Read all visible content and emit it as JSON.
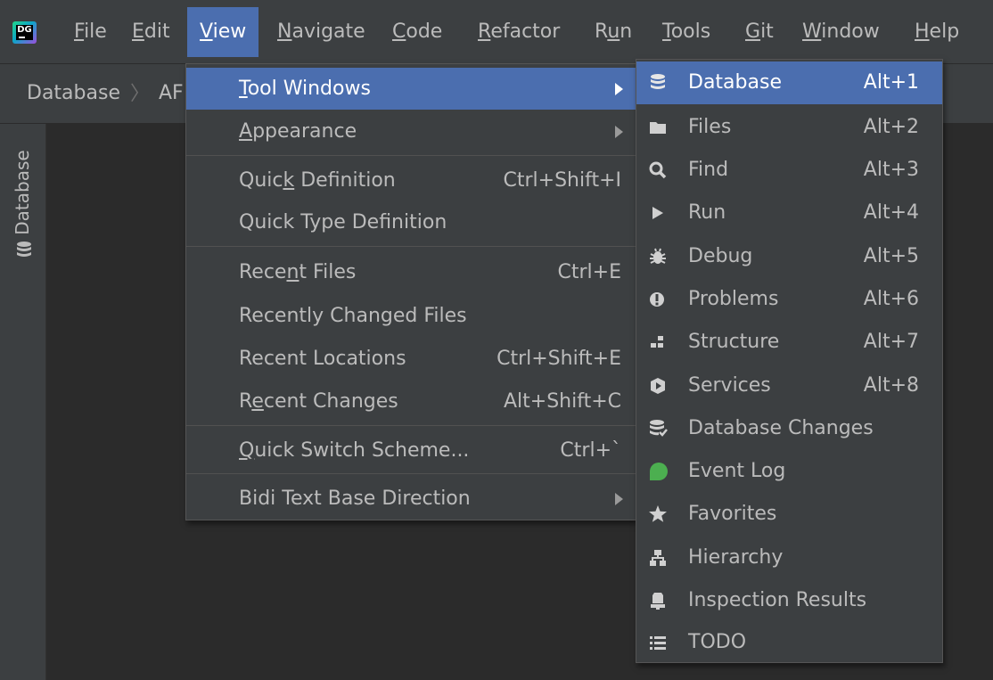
{
  "menubar": {
    "logo_text": "DG",
    "items": [
      {
        "pre": "",
        "u": "F",
        "post": "ile"
      },
      {
        "pre": "",
        "u": "E",
        "post": "dit"
      },
      {
        "pre": "",
        "u": "V",
        "post": "iew"
      },
      {
        "pre": "",
        "u": "N",
        "post": "avigate"
      },
      {
        "pre": "",
        "u": "C",
        "post": "ode"
      },
      {
        "pre": "",
        "u": "R",
        "post": "efactor"
      },
      {
        "pre": "R",
        "u": "u",
        "post": "n"
      },
      {
        "pre": "",
        "u": "T",
        "post": "ools"
      },
      {
        "pre": "",
        "u": "G",
        "post": "it"
      },
      {
        "pre": "",
        "u": "W",
        "post": "indow"
      },
      {
        "pre": "",
        "u": "H",
        "post": "elp"
      }
    ]
  },
  "breadcrumbs": {
    "first": "Database",
    "second": "AF"
  },
  "side_stripe": {
    "label": "Database"
  },
  "view_menu": {
    "items": [
      {
        "pre": "",
        "u": "T",
        "post": "ool Windows",
        "shortcut": ""
      },
      {
        "pre": "",
        "u": "A",
        "post": "ppearance",
        "shortcut": ""
      },
      {
        "pre": "Quic",
        "u": "k",
        "post": " Definition",
        "shortcut": "Ctrl+Shift+I"
      },
      {
        "pre": "Quick Type Definition",
        "u": "",
        "post": "",
        "shortcut": ""
      },
      {
        "pre": "Rece",
        "u": "n",
        "post": "t Files",
        "shortcut": "Ctrl+E"
      },
      {
        "pre": "Recently Changed Files",
        "u": "",
        "post": "",
        "shortcut": ""
      },
      {
        "pre": "Recent Locations",
        "u": "",
        "post": "",
        "shortcut": "Ctrl+Shift+E"
      },
      {
        "pre": "R",
        "u": "e",
        "post": "cent Changes",
        "shortcut": "Alt+Shift+C"
      },
      {
        "pre": "",
        "u": "Q",
        "post": "uick Switch Scheme...",
        "shortcut": "Ctrl+`"
      },
      {
        "pre": "Bidi Text Base Direction",
        "u": "",
        "post": "",
        "shortcut": ""
      }
    ]
  },
  "tool_windows": {
    "items": [
      {
        "label": "Database",
        "shortcut": "Alt+1",
        "icon": "database-icon"
      },
      {
        "label": "Files",
        "shortcut": "Alt+2",
        "icon": "folder-icon"
      },
      {
        "label": "Find",
        "shortcut": "Alt+3",
        "icon": "search-icon"
      },
      {
        "label": "Run",
        "shortcut": "Alt+4",
        "icon": "play-icon"
      },
      {
        "label": "Debug",
        "shortcut": "Alt+5",
        "icon": "bug-icon"
      },
      {
        "label": "Problems",
        "shortcut": "Alt+6",
        "icon": "warning-icon"
      },
      {
        "label": "Structure",
        "shortcut": "Alt+7",
        "icon": "structure-icon"
      },
      {
        "label": "Services",
        "shortcut": "Alt+8",
        "icon": "services-icon"
      },
      {
        "label": "Database Changes",
        "shortcut": "",
        "icon": "database-changes-icon"
      },
      {
        "label": "Event Log",
        "shortcut": "",
        "icon": "event-log-icon"
      },
      {
        "label": "Favorites",
        "shortcut": "",
        "icon": "star-icon"
      },
      {
        "label": "Hierarchy",
        "shortcut": "",
        "icon": "hierarchy-icon"
      },
      {
        "label": "Inspection Results",
        "shortcut": "",
        "icon": "inspection-icon"
      },
      {
        "label": "TODO",
        "shortcut": "",
        "icon": "todo-icon"
      }
    ]
  },
  "colors": {
    "selection": "#4b6eaf",
    "background": "#2b2b2b",
    "panel": "#3c3f41",
    "event_log_green": "#4caf50"
  }
}
